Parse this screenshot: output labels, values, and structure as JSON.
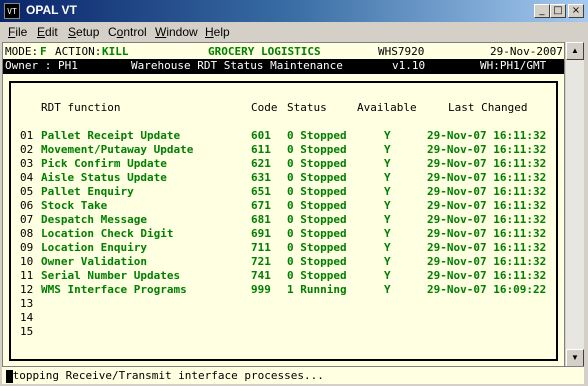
{
  "window": {
    "title": "OPAL VT",
    "icon": "VT",
    "minimize_glyph": "_",
    "maximize_glyph": "□",
    "close_glyph": "×"
  },
  "menu": [
    {
      "pre": "",
      "ul": "F",
      "post": "ile"
    },
    {
      "pre": "",
      "ul": "E",
      "post": "dit"
    },
    {
      "pre": "",
      "ul": "S",
      "post": "etup"
    },
    {
      "pre": "C",
      "ul": "o",
      "post": "ntrol"
    },
    {
      "pre": "",
      "ul": "W",
      "post": "indow"
    },
    {
      "pre": "",
      "ul": "H",
      "post": "elp"
    }
  ],
  "header": {
    "mode_label": "MODE:",
    "mode_value": "F",
    "action_label": "ACTION:",
    "action_value": "KILL",
    "system": "GROCERY LOGISTICS",
    "code": "WHS7920",
    "date": "29-Nov-2007",
    "owner": "Owner : PH1",
    "screen_title": "Warehouse RDT Status Maintenance",
    "version": "v1.10",
    "wh": "WH:PH1/GMT"
  },
  "table": {
    "columns": {
      "function": "RDT function",
      "code": "Code",
      "status": "Status",
      "available": "Available",
      "changed": "Last Changed"
    },
    "rows": [
      {
        "num": "01",
        "function": "Pallet Receipt Update",
        "code": "601",
        "status": "0 Stopped",
        "available": "Y",
        "changed": "29-Nov-07 16:11:32"
      },
      {
        "num": "02",
        "function": "Movement/Putaway Update",
        "code": "611",
        "status": "0 Stopped",
        "available": "Y",
        "changed": "29-Nov-07 16:11:32"
      },
      {
        "num": "03",
        "function": "Pick Confirm Update",
        "code": "621",
        "status": "0 Stopped",
        "available": "Y",
        "changed": "29-Nov-07 16:11:32"
      },
      {
        "num": "04",
        "function": "Aisle Status Update",
        "code": "631",
        "status": "0 Stopped",
        "available": "Y",
        "changed": "29-Nov-07 16:11:32"
      },
      {
        "num": "05",
        "function": "Pallet Enquiry",
        "code": "651",
        "status": "0 Stopped",
        "available": "Y",
        "changed": "29-Nov-07 16:11:32"
      },
      {
        "num": "06",
        "function": "Stock Take",
        "code": "671",
        "status": "0 Stopped",
        "available": "Y",
        "changed": "29-Nov-07 16:11:32"
      },
      {
        "num": "07",
        "function": "Despatch Message",
        "code": "681",
        "status": "0 Stopped",
        "available": "Y",
        "changed": "29-Nov-07 16:11:32"
      },
      {
        "num": "08",
        "function": "Location Check Digit",
        "code": "691",
        "status": "0 Stopped",
        "available": "Y",
        "changed": "29-Nov-07 16:11:32"
      },
      {
        "num": "09",
        "function": "Location Enquiry",
        "code": "711",
        "status": "0 Stopped",
        "available": "Y",
        "changed": "29-Nov-07 16:11:32"
      },
      {
        "num": "10",
        "function": "Owner Validation",
        "code": "721",
        "status": "0 Stopped",
        "available": "Y",
        "changed": "29-Nov-07 16:11:32"
      },
      {
        "num": "11",
        "function": "Serial Number Updates",
        "code": "741",
        "status": "0 Stopped",
        "available": "Y",
        "changed": "29-Nov-07 16:11:32"
      },
      {
        "num": "12",
        "function": "WMS Interface Programs",
        "code": "999",
        "status": "1 Running",
        "available": "Y",
        "changed": "29-Nov-07 16:09:22"
      },
      {
        "num": "13",
        "function": "",
        "code": "",
        "status": "",
        "available": "",
        "changed": ""
      },
      {
        "num": "14",
        "function": "",
        "code": "",
        "status": "",
        "available": "",
        "changed": ""
      },
      {
        "num": "15",
        "function": "",
        "code": "",
        "status": "",
        "available": "",
        "changed": ""
      }
    ]
  },
  "status_message": "Stopping Receive/Transmit interface processes...",
  "scrollbar": {
    "up_glyph": "▲",
    "down_glyph": "▼"
  },
  "colors": {
    "terminal_bg": "#ffffe1",
    "field_green": "#008000",
    "titlebar": "#0a246a"
  }
}
